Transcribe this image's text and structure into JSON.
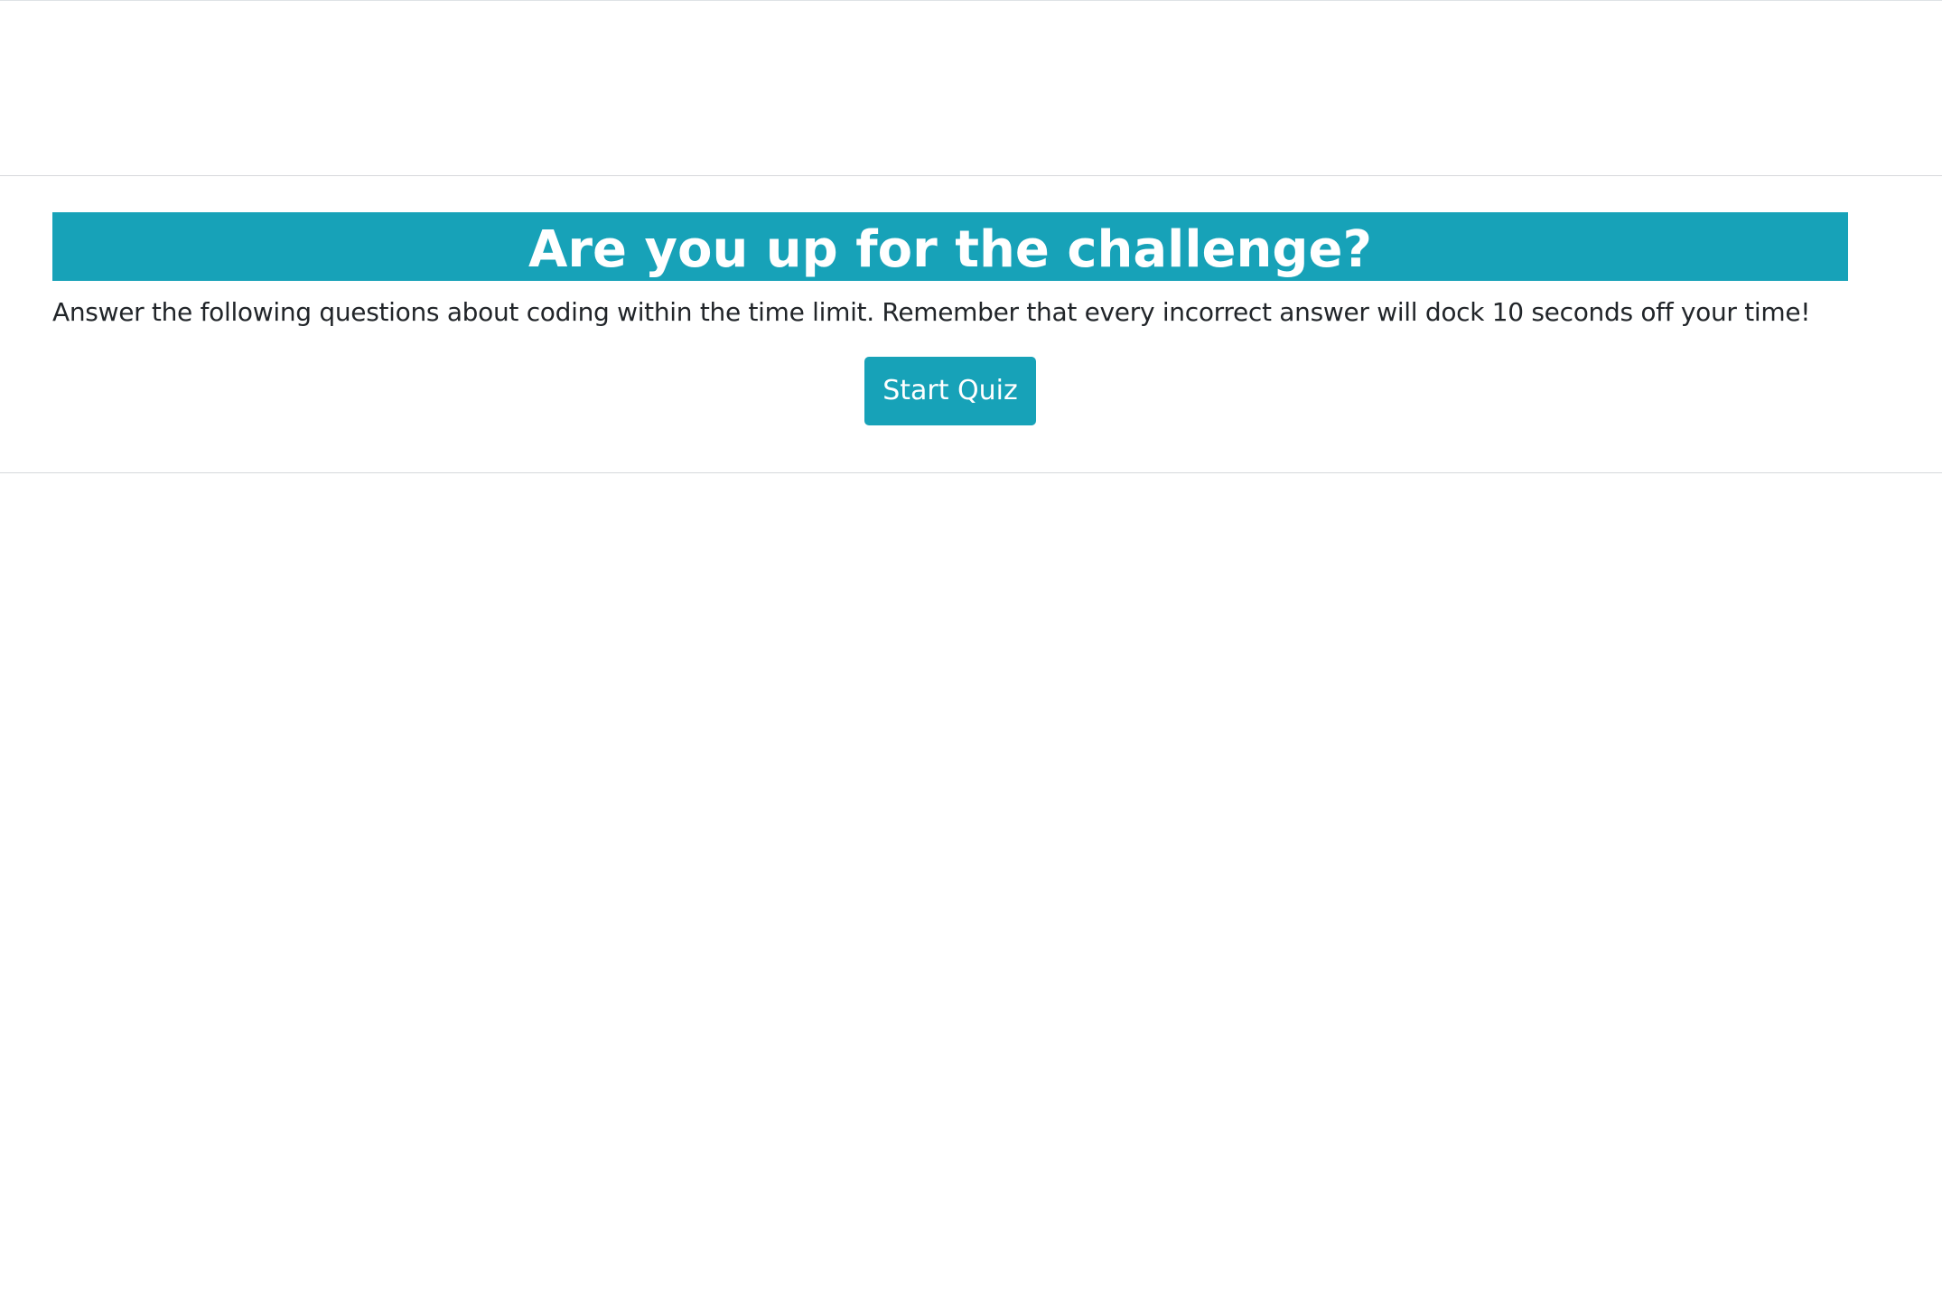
{
  "quiz": {
    "title": "Are you up for the challenge?",
    "instructions": "Answer the following questions about coding within the time limit. Remember that every incorrect answer will dock 10 seconds off your time!",
    "start_label": "Start Quiz"
  },
  "colors": {
    "accent": "#17a2b8",
    "text": "#212529",
    "divider": "#d6d8db",
    "background": "#ffffff"
  }
}
